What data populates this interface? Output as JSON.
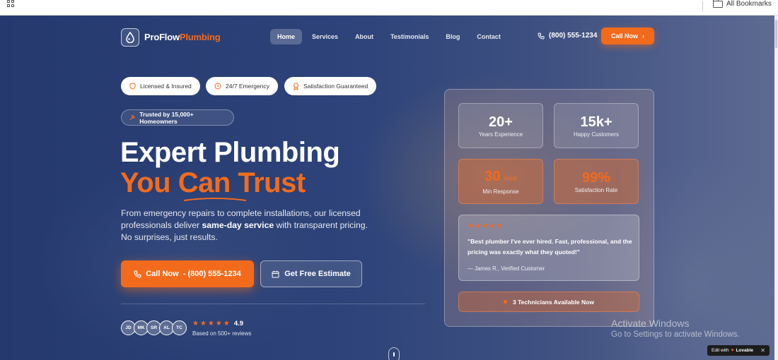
{
  "browser": {
    "bookmarks_label": "All Bookmarks"
  },
  "nav": {
    "brand_part1": "ProFlow",
    "brand_part2": "Plumbing",
    "links": [
      "Home",
      "Services",
      "About",
      "Testimonials",
      "Blog",
      "Contact"
    ],
    "active_link": "Home",
    "phone": "(800) 555-1234",
    "call_button": "Call Now"
  },
  "badges": [
    "Licensed & Insured",
    "24/7 Emergency",
    "Satisfaction Guaranteed"
  ],
  "trusted": "Trusted by 15,000+ Homeowners",
  "headline": {
    "line1": "Expert Plumbing",
    "line2": "You Can Trust"
  },
  "description": {
    "part1": "From emergency repairs to complete installations, our licensed professionals deliver ",
    "bold": "same-day service",
    "part2": " with transparent pricing. No surprises, just results."
  },
  "cta": {
    "call": "Call Now  - (800) 555-1234",
    "estimate": "Get Free Estimate"
  },
  "reviews": {
    "avatars": [
      "JD",
      "MK",
      "SR",
      "AL",
      "TC"
    ],
    "rating": "4.9",
    "stars": 5,
    "based_on": "Based on 500+ reviews"
  },
  "stats": [
    {
      "num": "20+",
      "unit": "",
      "label": "Years Experience",
      "style": "white"
    },
    {
      "num": "15k+",
      "unit": "",
      "label": "Happy Customers",
      "style": "white"
    },
    {
      "num": "30",
      "unit": "min",
      "label": "Min Response",
      "style": "orange"
    },
    {
      "num": "99%",
      "unit": "",
      "label": "Satisfaction Rate",
      "style": "orange"
    }
  ],
  "testimonial": {
    "stars": 5,
    "quote": "\"Best plumber I've ever hired. Fast, professional, and the pricing was exactly what they quoted!\"",
    "author": "— James R., Verified Customer"
  },
  "availability": "3 Technicians Available Now",
  "overlays": {
    "activate_title": "Activate Windows",
    "activate_sub": "Go to Settings to activate Windows.",
    "edit_with": "Edit with",
    "lovable": "Lovable",
    "close": "✕"
  },
  "colors": {
    "accent": "#f26b1d",
    "hero_bg": "#2d4379"
  }
}
